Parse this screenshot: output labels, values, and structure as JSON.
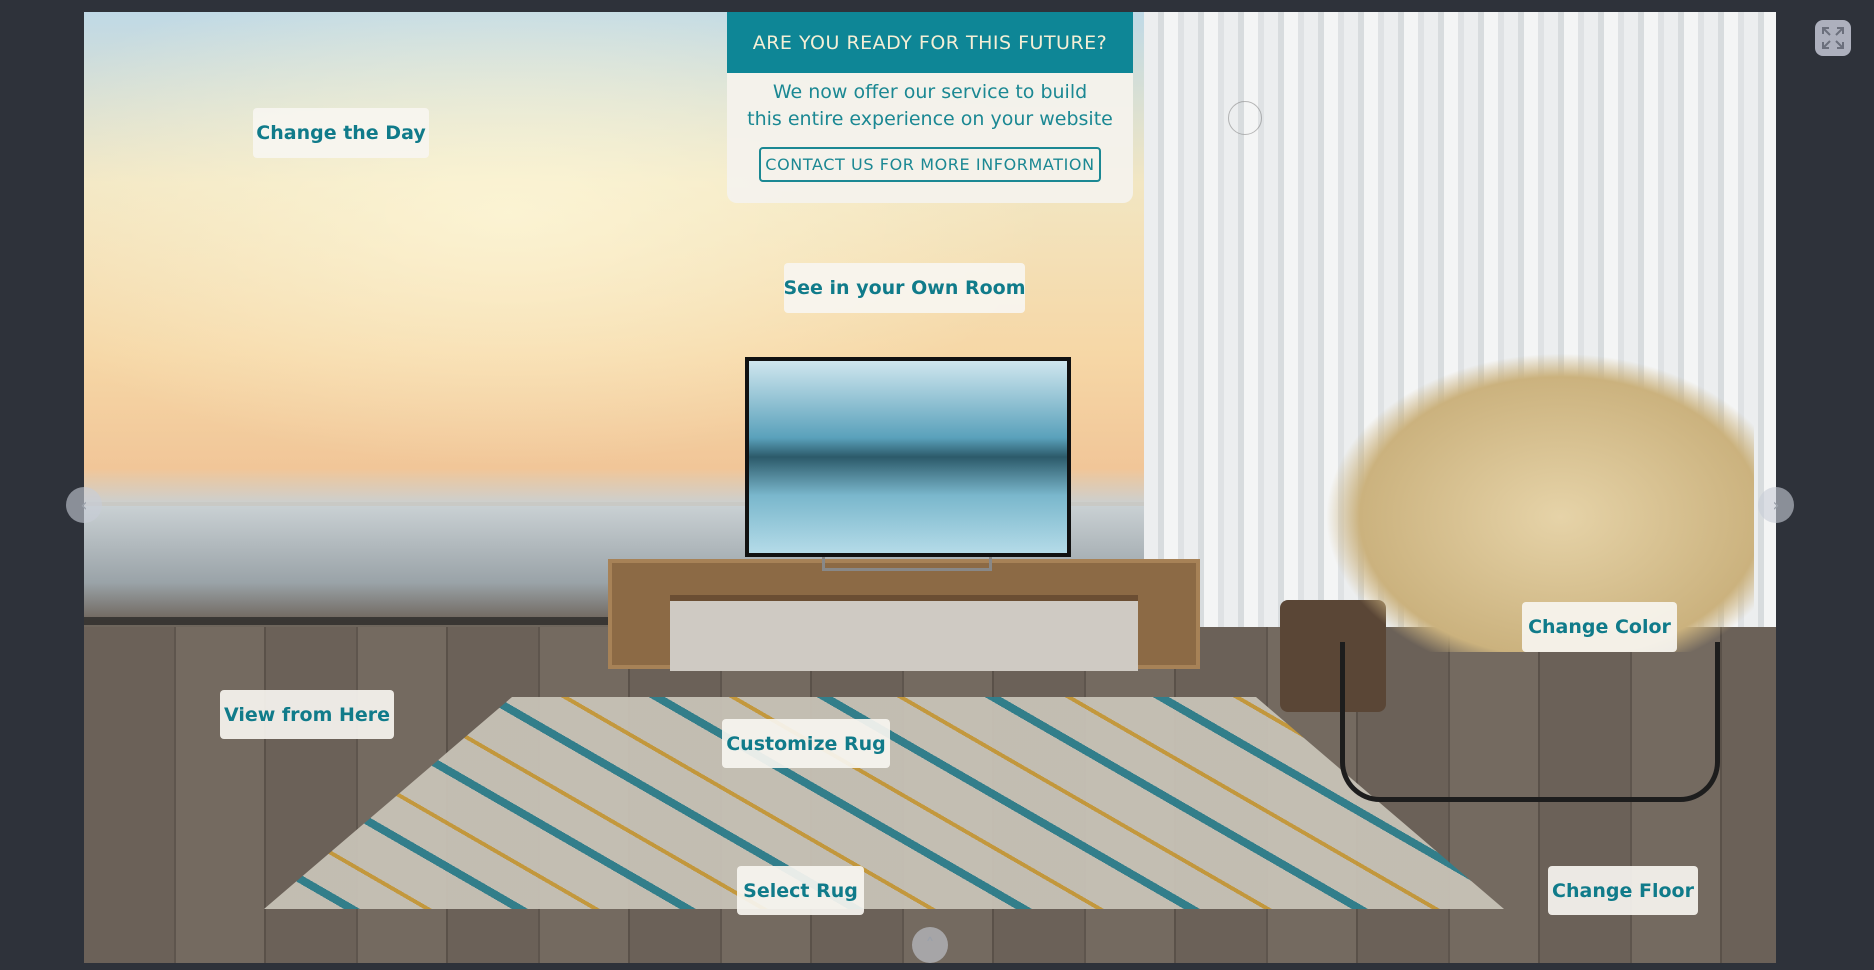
{
  "popup": {
    "title": "ARE YOU READY FOR THIS FUTURE?",
    "line1": "We now offer our service to build",
    "line2": "this entire experience on your website",
    "button": "CONTACT US FOR MORE INFORMATION"
  },
  "hotspots": {
    "change_day": "Change the Day",
    "own_room": "See in your Own Room",
    "view_here": "View from Here",
    "customize_rug": "Customize Rug",
    "select_rug": "Select Rug",
    "change_color": "Change Color",
    "change_floor": "Change Floor"
  },
  "nav": {
    "prev": "‹",
    "next": "›",
    "up": "˄"
  },
  "icons": {
    "fullscreen": "expand-icon"
  },
  "colors": {
    "accent": "#0e8696",
    "text": "#107b8a"
  }
}
